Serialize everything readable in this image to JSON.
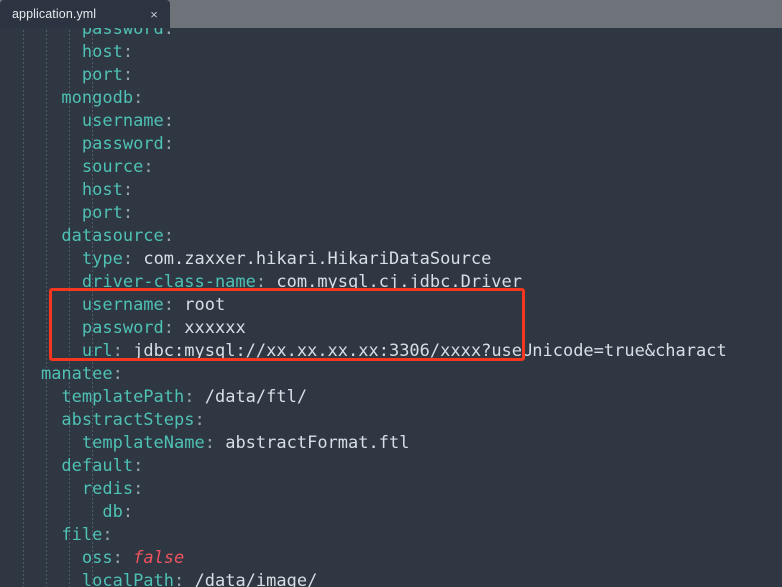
{
  "window": {
    "background_color": "#2e3742",
    "tabbar_color": "#6e737a"
  },
  "tabbar": {
    "tabs": [
      {
        "label": "application.yml",
        "active": true,
        "close_glyph": "×"
      }
    ]
  },
  "editor": {
    "language": "yaml",
    "colors": {
      "background": "#2e3742",
      "key": "#4fc1b4",
      "value": "#d8dee4",
      "punctuation": "#9aa4af",
      "boolean": "#ef5360",
      "indent_guide": "#566170",
      "annotation_box": "#f5371f"
    },
    "annotation": {
      "shape": "rectangle",
      "color": "#f5371f",
      "covers_lines": [
        "username: root",
        "password: xxxxxx",
        "url: jdbc:mysql://xx.xx.xx.xx:3306/xxxx?"
      ]
    },
    "lines": [
      {
        "indent": 4,
        "key": "password",
        "value": ""
      },
      {
        "indent": 4,
        "key": "host",
        "value": ""
      },
      {
        "indent": 4,
        "key": "port",
        "value": ""
      },
      {
        "indent": 2,
        "key": "mongodb",
        "value": ""
      },
      {
        "indent": 4,
        "key": "username",
        "value": ""
      },
      {
        "indent": 4,
        "key": "password",
        "value": ""
      },
      {
        "indent": 4,
        "key": "source",
        "value": ""
      },
      {
        "indent": 4,
        "key": "host",
        "value": ""
      },
      {
        "indent": 4,
        "key": "port",
        "value": ""
      },
      {
        "indent": 2,
        "key": "datasource",
        "value": ""
      },
      {
        "indent": 4,
        "key": "type",
        "value": "com.zaxxer.hikari.HikariDataSource"
      },
      {
        "indent": 4,
        "key": "driver-class-name",
        "value": "com.mysql.cj.jdbc.Driver"
      },
      {
        "indent": 4,
        "key": "username",
        "value": "root"
      },
      {
        "indent": 4,
        "key": "password",
        "value": "xxxxxx"
      },
      {
        "indent": 4,
        "key": "url",
        "value": "jdbc:mysql://xx.xx.xx.xx:3306/xxxx?useUnicode=true&charact"
      },
      {
        "indent": 0,
        "key": "manatee",
        "value": ""
      },
      {
        "indent": 2,
        "key": "templatePath",
        "value": "/data/ftl/"
      },
      {
        "indent": 2,
        "key": "abstractSteps",
        "value": ""
      },
      {
        "indent": 4,
        "key": "templateName",
        "value": "abstractFormat.ftl"
      },
      {
        "indent": 2,
        "key": "default",
        "value": ""
      },
      {
        "indent": 4,
        "key": "redis",
        "value": ""
      },
      {
        "indent": 6,
        "key": "db",
        "value": ""
      },
      {
        "indent": 2,
        "key": "file",
        "value": ""
      },
      {
        "indent": 4,
        "key": "oss",
        "value": "false",
        "value_type": "boolean"
      },
      {
        "indent": 4,
        "key": "localPath",
        "value": "/data/image/"
      }
    ]
  }
}
